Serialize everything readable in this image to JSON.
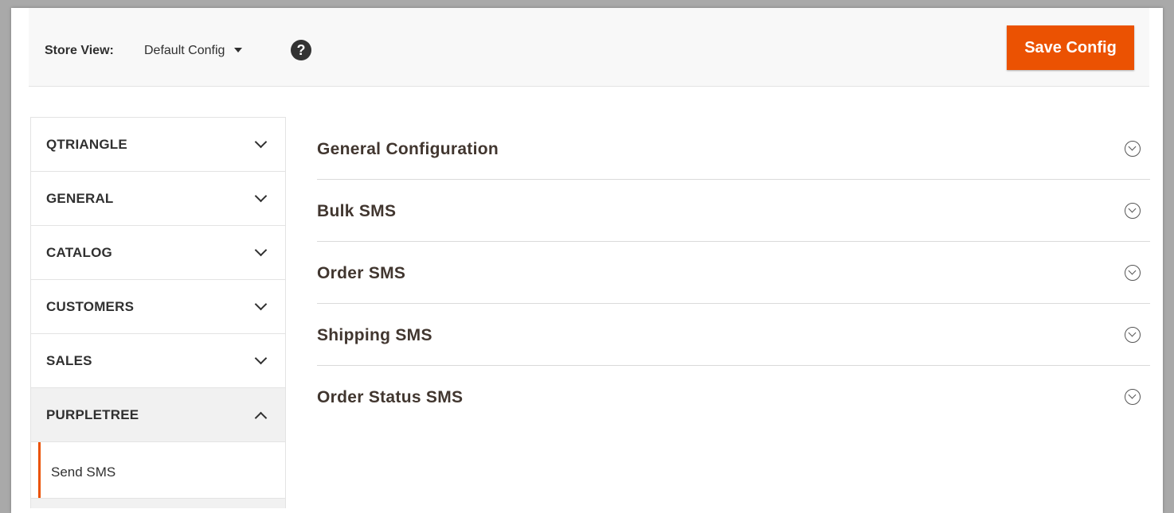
{
  "scope": {
    "store_view_label": "Store View:",
    "store_view_value": "Default Config",
    "help_glyph": "?",
    "help_icon": "question-circle-icon"
  },
  "actions": {
    "save_label": "Save Config",
    "accent_color": "#eb5202"
  },
  "sidebar": {
    "tabs": [
      {
        "label": "QTRIANGLE",
        "expanded": false
      },
      {
        "label": "GENERAL",
        "expanded": false
      },
      {
        "label": "CATALOG",
        "expanded": false
      },
      {
        "label": "CUSTOMERS",
        "expanded": false
      },
      {
        "label": "SALES",
        "expanded": false
      },
      {
        "label": "PURPLETREE",
        "expanded": true
      }
    ],
    "subitems": [
      {
        "label": "Send SMS",
        "active": true
      }
    ]
  },
  "main": {
    "sections": [
      {
        "title": "General Configuration",
        "icon": "chevron-circle-down-icon"
      },
      {
        "title": "Bulk SMS",
        "icon": "chevron-circle-down-icon"
      },
      {
        "title": "Order SMS",
        "icon": "chevron-circle-down-icon"
      },
      {
        "title": "Shipping SMS",
        "icon": "chevron-circle-down-icon"
      },
      {
        "title": "Order Status SMS",
        "icon": "chevron-circle-down-icon"
      }
    ]
  }
}
